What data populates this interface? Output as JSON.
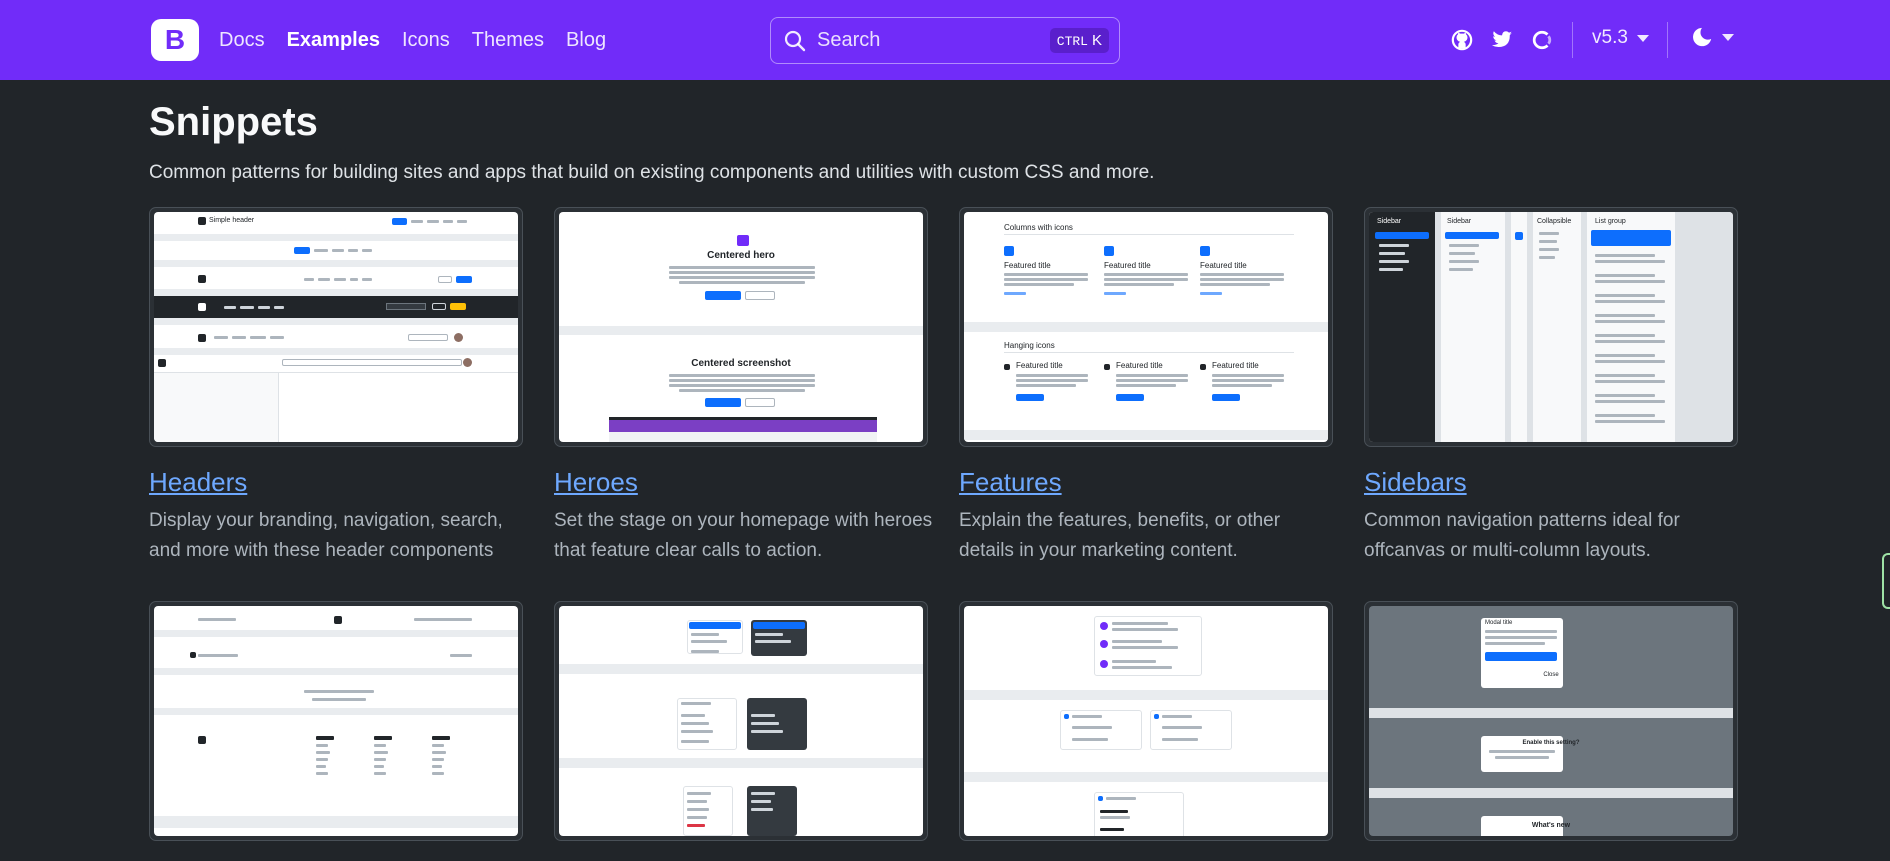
{
  "nav": {
    "brand": "B",
    "links": [
      "Docs",
      "Examples",
      "Icons",
      "Themes",
      "Blog"
    ],
    "search_placeholder": "Search",
    "search_shortcut_key": "CTRL",
    "search_shortcut_letter": "K",
    "version": "v5.3",
    "icons": [
      "github-icon",
      "twitter-icon",
      "opencollective-icon",
      "moon-icon"
    ]
  },
  "page": {
    "title": "Snippets",
    "lead": "Common patterns for building sites and apps that build on existing components and utilities with custom CSS and more."
  },
  "cards": [
    {
      "title": "Headers",
      "desc": "Display your branding, navigation, search, and more with these header components"
    },
    {
      "title": "Heroes",
      "desc": "Set the stage on your homepage with heroes that feature clear calls to action."
    },
    {
      "title": "Features",
      "desc": "Explain the features, benefits, or other details in your marketing content."
    },
    {
      "title": "Sidebars",
      "desc": "Common navigation patterns ideal for offcanvas or multi-column layouts."
    }
  ],
  "thumbs": {
    "headers": {
      "label": "Simple header"
    },
    "heroes": {
      "hero1": "Centered hero",
      "hero2": "Centered screenshot",
      "primary": "Primary button",
      "secondary": "Secondary"
    },
    "features": {
      "heading1": "Columns with icons",
      "heading2": "Hanging icons",
      "feature_title": "Featured title"
    },
    "sidebars": {
      "label1": "Sidebar",
      "label2": "Sidebar",
      "label3": "Collapsible",
      "label4": "List group"
    },
    "modals": {
      "title": "Modal title",
      "confirm": "Enable this setting?",
      "whats_new": "What's new",
      "save": "Save changes",
      "close": "Close"
    }
  },
  "colors": {
    "navbar": "#712cf9",
    "body": "#212529",
    "link": "#6ea8fe"
  }
}
